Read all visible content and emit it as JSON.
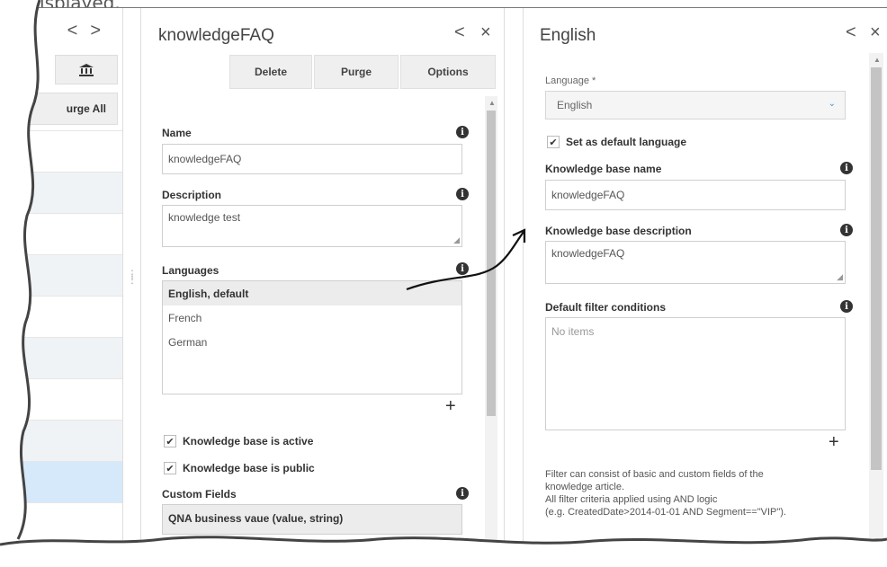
{
  "caption": "be displayed.",
  "left": {
    "nav_prev": "<",
    "nav_next": ">",
    "bank_icon": "bank-icon",
    "purge_all_label": "urge All"
  },
  "middle": {
    "title": "knowledgeFAQ",
    "back": "<",
    "close": "×",
    "toolbar": {
      "delete": "Delete",
      "purge": "Purge",
      "options": "Options"
    },
    "name": {
      "label": "Name",
      "value": "knowledgeFAQ"
    },
    "description": {
      "label": "Description",
      "value": "knowledge test"
    },
    "languages": {
      "label": "Languages",
      "items": [
        "English, default",
        "French",
        "German"
      ],
      "add": "+"
    },
    "checks": {
      "active": "Knowledge base is active",
      "public": "Knowledge base is public"
    },
    "custom_fields": {
      "label": "Custom Fields",
      "item": "QNA business vaue (value, string)"
    }
  },
  "right": {
    "title": "English",
    "back": "<",
    "close": "×",
    "language": {
      "label": "Language *",
      "value": "English"
    },
    "default_check": "Set as default language",
    "kb_name": {
      "label": "Knowledge base name",
      "value": "knowledgeFAQ"
    },
    "kb_desc": {
      "label": "Knowledge base description",
      "value": "knowledgeFAQ"
    },
    "filter": {
      "label": "Default filter conditions",
      "placeholder": "No items",
      "add": "+"
    },
    "help": [
      "Filter can consist of basic and custom fields of the",
      "knowledge article.",
      "All filter criteria applied using AND logic",
      "(e.g. CreatedDate>2014-01-01 AND Segment==\"VIP\")."
    ]
  },
  "colors": {
    "selected_row": "#d6e9fb",
    "caret": "#4a90d9"
  }
}
